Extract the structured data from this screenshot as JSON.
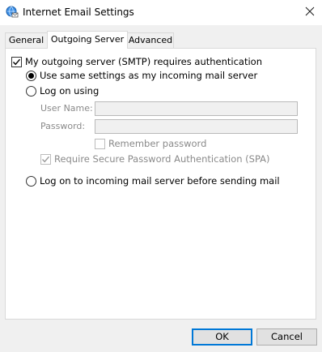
{
  "window": {
    "title": "Internet Email Settings",
    "icon": "globe-envelope-icon",
    "close_icon": "close-icon"
  },
  "tabs": [
    {
      "label": "General",
      "active": false
    },
    {
      "label": "Outgoing Server",
      "active": true
    },
    {
      "label": "Advanced",
      "active": false
    }
  ],
  "outgoing": {
    "smtp_auth_label": "My outgoing server (SMTP) requires authentication",
    "smtp_auth_checked": true,
    "use_same_label": "Use same settings as my incoming mail server",
    "use_same_selected": true,
    "log_on_using_label": "Log on using",
    "log_on_using_selected": false,
    "user_name_label": "User Name:",
    "user_name_value": "",
    "password_label": "Password:",
    "password_value": "",
    "remember_password_label": "Remember password",
    "remember_password_checked": false,
    "spa_label": "Require Secure Password Authentication (SPA)",
    "spa_checked": true,
    "log_on_incoming_label": "Log on to incoming mail server before sending mail",
    "log_on_incoming_selected": false
  },
  "buttons": {
    "ok": "OK",
    "cancel": "Cancel"
  },
  "colors": {
    "accent": "#0078d7",
    "dialog_bg": "#f0f0f0",
    "disabled_text": "#8a8a8a"
  }
}
